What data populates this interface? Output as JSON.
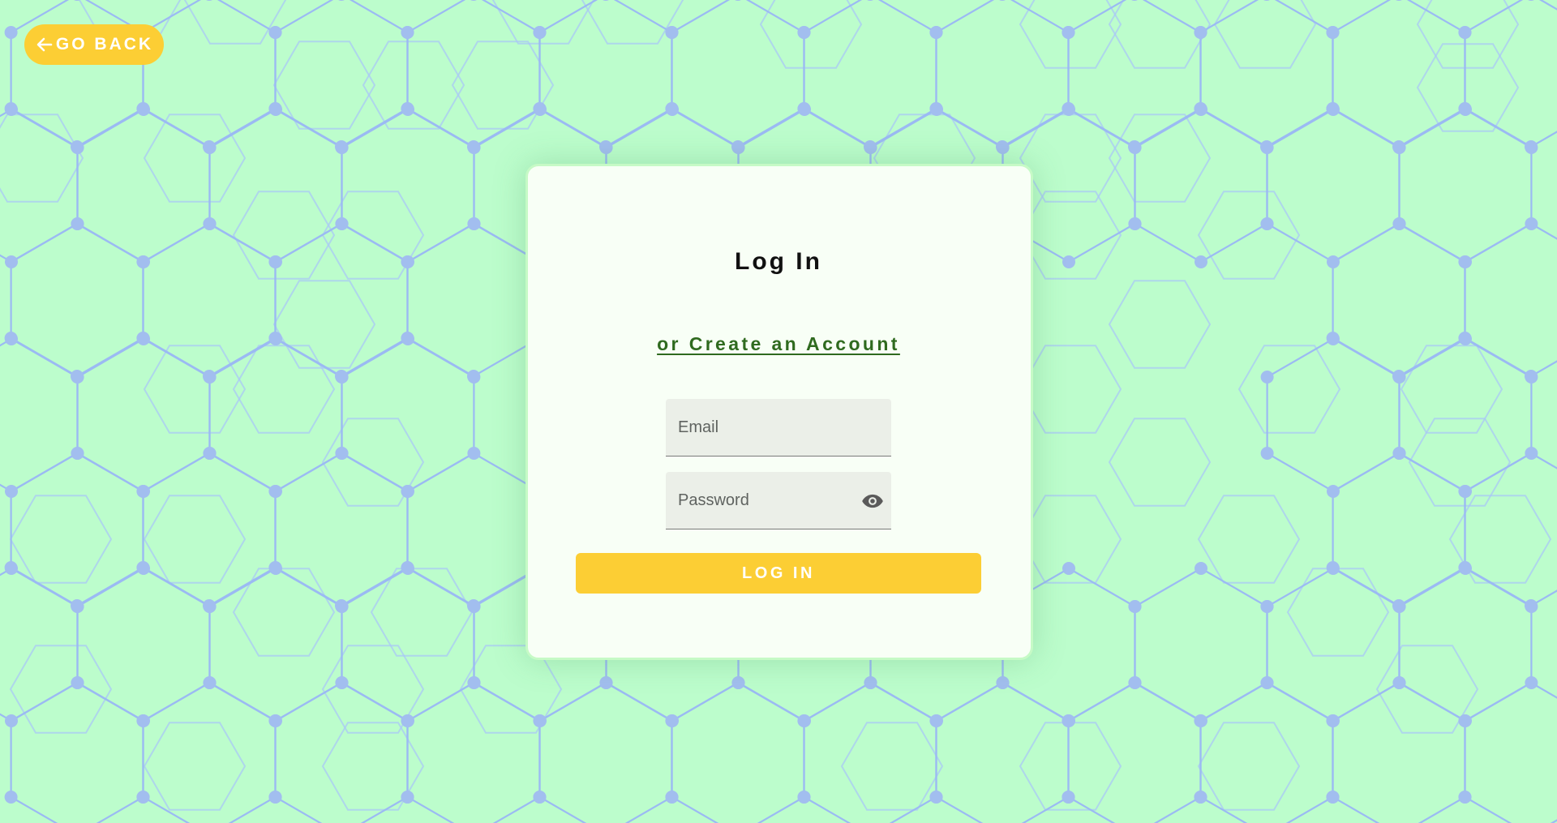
{
  "nav": {
    "back_label": "GO BACK",
    "back_icon": "arrow-left-icon"
  },
  "login": {
    "title": "Log In",
    "create_account_link": "or Create an Account",
    "email_placeholder": "Email",
    "password_placeholder": "Password",
    "visibility_icon": "eye-icon",
    "submit_label": "LOG IN"
  },
  "colors": {
    "background": "#bcfdcc",
    "accent": "#fcce34",
    "link": "#2f6a1f",
    "card": "#f8fff6",
    "hex_line": "#9bbaf3",
    "hex_node": "#a2beef",
    "hex_outline": "#aac8f6"
  }
}
